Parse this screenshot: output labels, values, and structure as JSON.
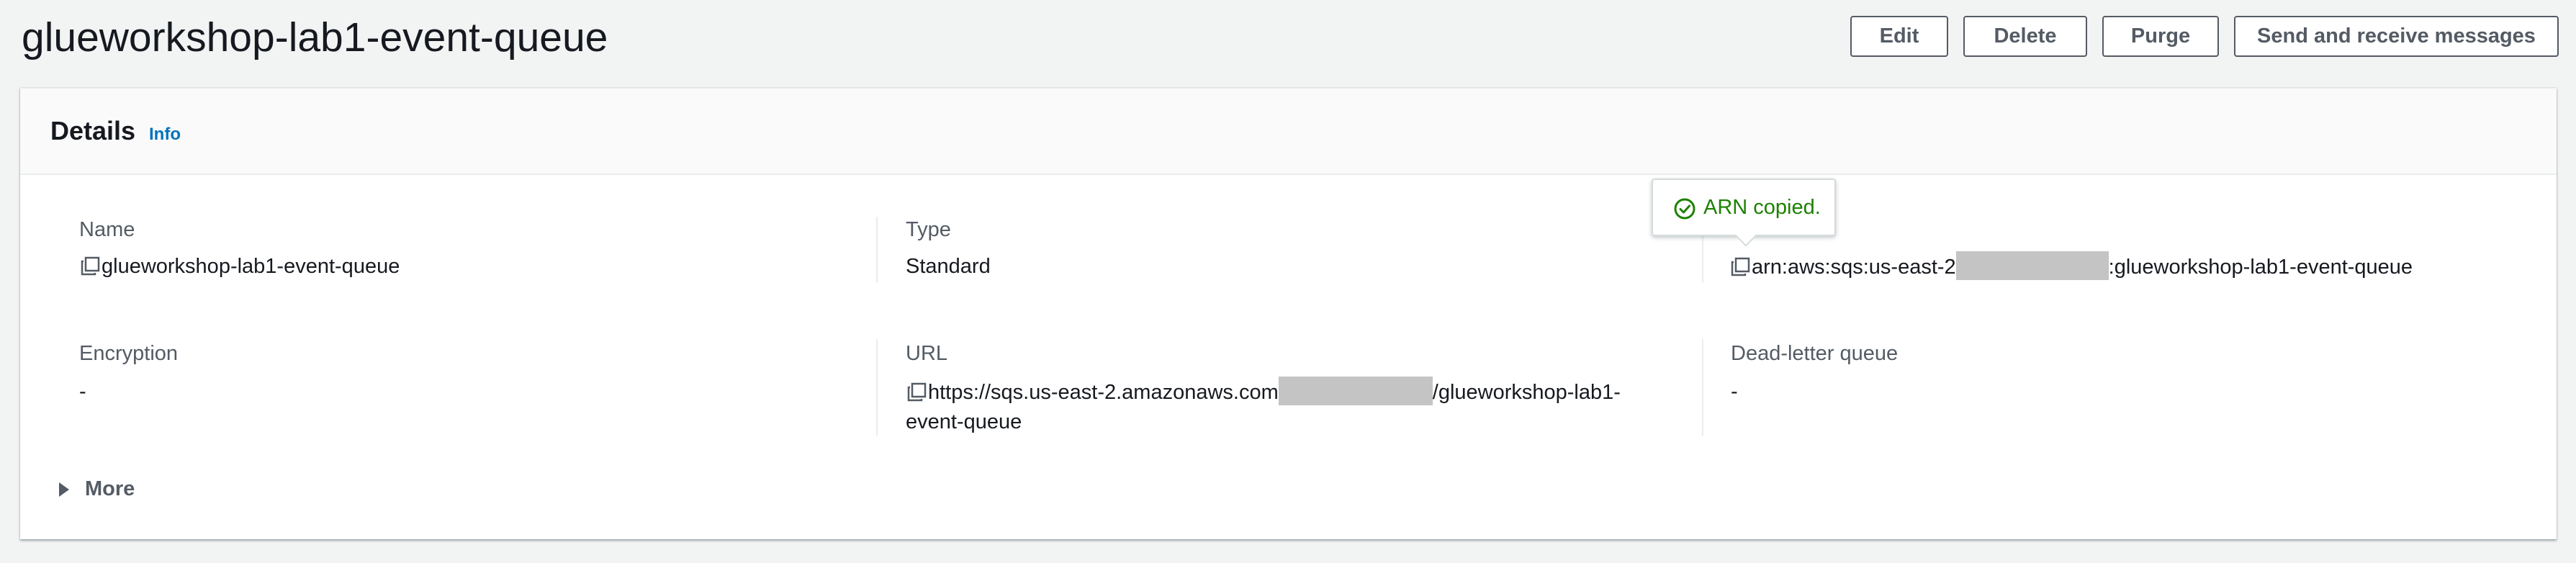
{
  "header": {
    "title": "glueworkshop-lab1-event-queue",
    "buttons": {
      "edit": "Edit",
      "delete": "Delete",
      "purge": "Purge",
      "send_receive": "Send and receive messages"
    }
  },
  "details": {
    "title": "Details",
    "info_link": "Info",
    "fields": {
      "name": {
        "label": "Name",
        "value": "glueworkshop-lab1-event-queue"
      },
      "type": {
        "label": "Type",
        "value": "Standard"
      },
      "arn": {
        "value_prefix": "arn:aws:sqs:us-east-2",
        "value_suffix": ":glueworkshop-lab1-event-queue"
      },
      "encryption": {
        "label": "Encryption",
        "value": "-"
      },
      "url": {
        "label": "URL",
        "value_prefix": "https://sqs.us-east-2.amazonaws.com",
        "value_suffix_line1": "/glueworkshop-lab1-",
        "value_suffix_line2": "event-queue"
      },
      "dead_letter_queue": {
        "label": "Dead-letter queue",
        "value": "-"
      }
    },
    "tooltip": {
      "text": "ARN copied.",
      "icon": "check-circle-icon"
    },
    "expander": {
      "label": "More"
    }
  },
  "colors": {
    "background": "#f2f3f3",
    "link": "#0073bb",
    "success": "#1d8102",
    "button_border": "#545b64",
    "redaction": "#c4c4c4"
  }
}
